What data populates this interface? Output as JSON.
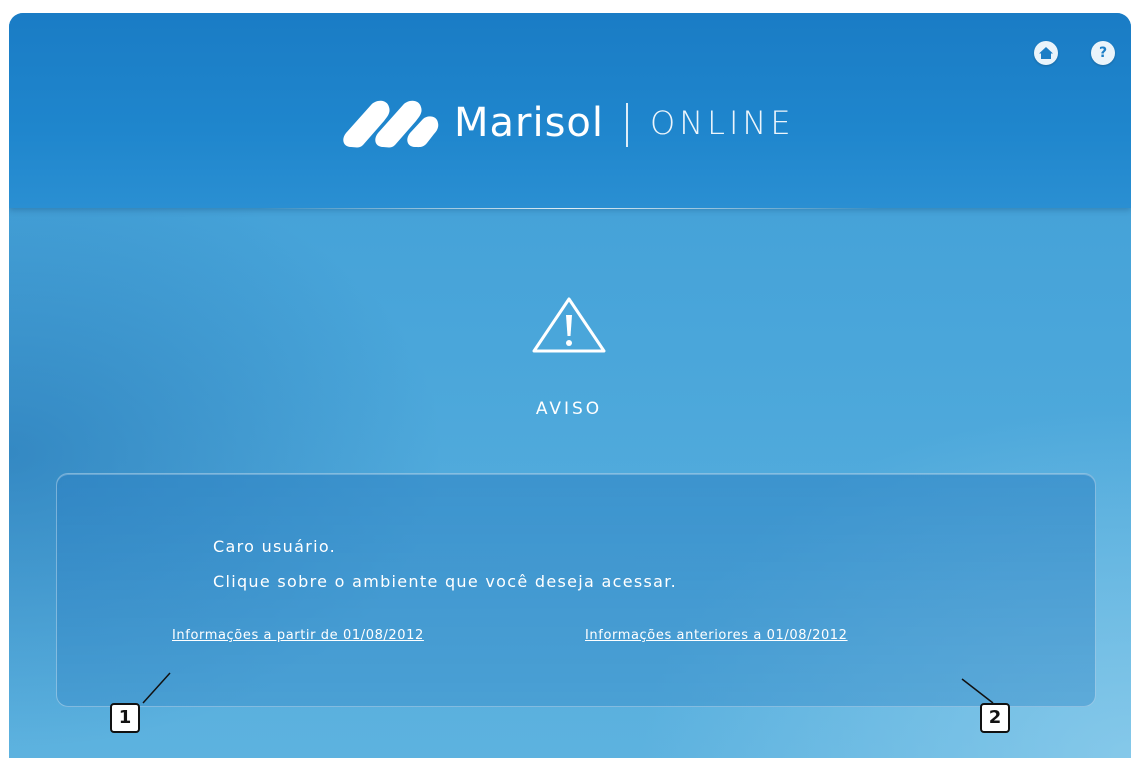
{
  "header": {
    "brand_name": "Marisol",
    "brand_suffix": "ONLINE",
    "home_button_icon": "home-icon",
    "help_button_label": "?"
  },
  "notice": {
    "icon": "warning-triangle-icon",
    "title": "AVISO",
    "greeting": "Caro usuário.",
    "instruction": "Clique sobre o ambiente que você deseja acessar."
  },
  "links": {
    "after": "Informações a partir de 01/08/2012",
    "before": "Informações anteriores a 01/08/2012"
  },
  "callouts": {
    "first": "1",
    "second": "2"
  },
  "colors": {
    "header": "#1f86cd",
    "background": "#4aa6da",
    "text": "#ffffff"
  }
}
